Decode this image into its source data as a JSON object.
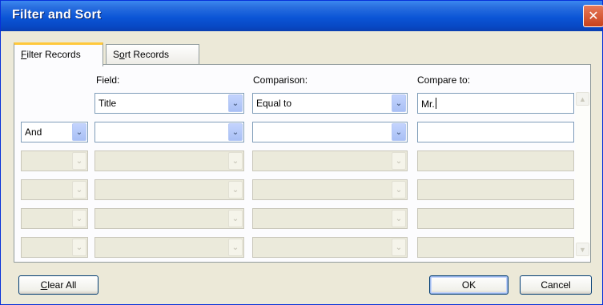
{
  "window": {
    "title": "Filter and Sort",
    "close_glyph": "✕"
  },
  "tabs": [
    {
      "prefix": "",
      "accel": "F",
      "rest": "ilter Records",
      "active": true
    },
    {
      "prefix": "S",
      "accel": "o",
      "rest": "rt Records",
      "active": false
    }
  ],
  "headers": {
    "field": "Field:",
    "comparison": "Comparison:",
    "compare_to": "Compare to:"
  },
  "rows": [
    {
      "conjunction": "",
      "field": "Title",
      "comparison": "Equal to",
      "compare_to": "Mr.",
      "enabled": true
    },
    {
      "conjunction": "And",
      "field": "",
      "comparison": "",
      "compare_to": "",
      "enabled": true
    },
    {
      "conjunction": "",
      "field": "",
      "comparison": "",
      "compare_to": "",
      "enabled": false
    },
    {
      "conjunction": "",
      "field": "",
      "comparison": "",
      "compare_to": "",
      "enabled": false
    },
    {
      "conjunction": "",
      "field": "",
      "comparison": "",
      "compare_to": "",
      "enabled": false
    },
    {
      "conjunction": "",
      "field": "",
      "comparison": "",
      "compare_to": "",
      "enabled": false
    }
  ],
  "icons": {
    "dropdown": "chevron-down-icon",
    "scroll_up": "chevron-up-icon",
    "scroll_down": "chevron-down-icon"
  },
  "buttons": {
    "clear_all": {
      "accel": "C",
      "rest": "lear All"
    },
    "ok": "OK",
    "cancel": "Cancel"
  }
}
